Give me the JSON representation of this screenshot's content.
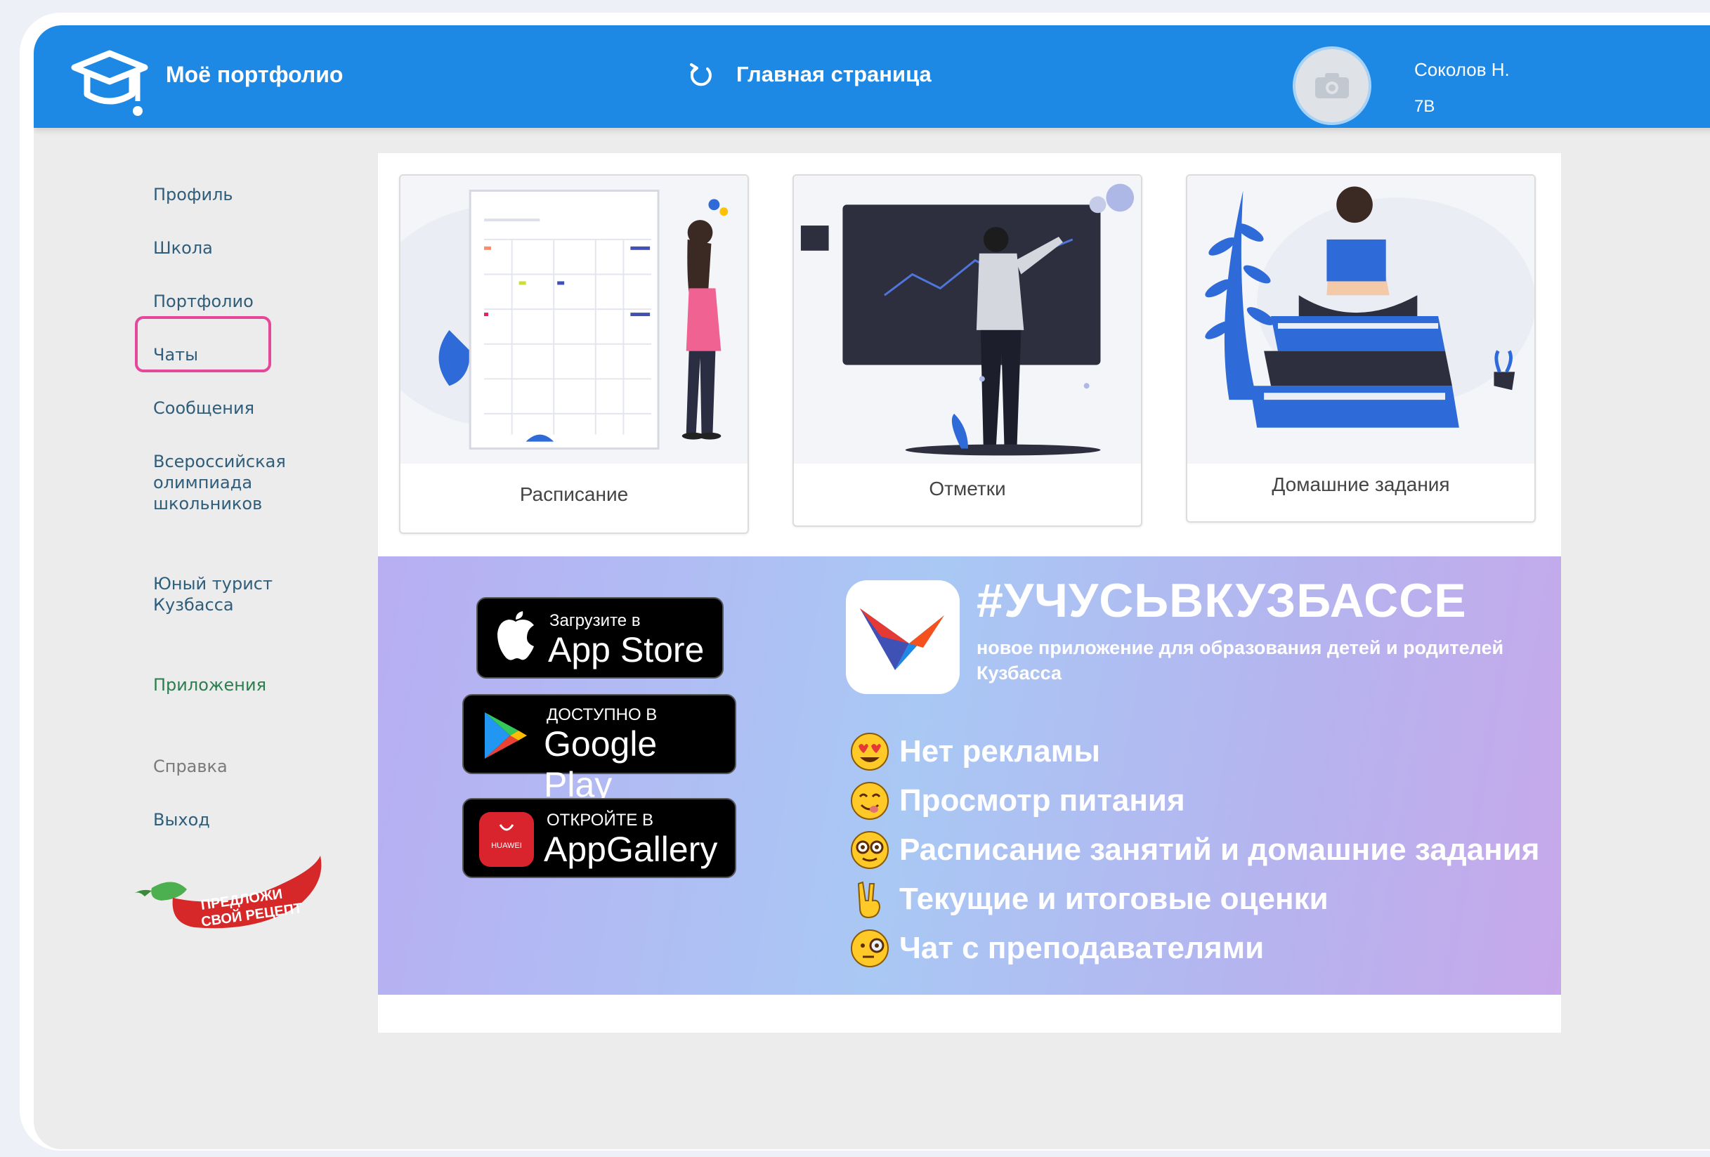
{
  "header": {
    "brand": "Моё портфолио",
    "home_label": "Главная страница",
    "user_name": "Соколов Н.",
    "user_class": "7В"
  },
  "sidebar": {
    "items": [
      {
        "label": "Профиль"
      },
      {
        "label": "Школа"
      },
      {
        "label": "Портфолио"
      },
      {
        "label": "Чаты"
      },
      {
        "label": "Сообщения"
      },
      {
        "label": "Всероссийская олимпиада школьников"
      },
      {
        "label": "Юный турист Кузбасса"
      },
      {
        "label": "Приложения"
      },
      {
        "label": "Справка"
      },
      {
        "label": "Выход"
      }
    ],
    "highlighted": "Чаты",
    "promo_text": "ПРЕДЛОЖИ СВОЙ РЕЦЕПТ"
  },
  "cards": [
    {
      "label": "Расписание"
    },
    {
      "label": "Отметки"
    },
    {
      "label": "Домашние задания"
    }
  ],
  "banner": {
    "stores": [
      {
        "small": "Загрузите в",
        "big": "App Store"
      },
      {
        "small": "ДОСТУПНО В",
        "big": "Google Play"
      },
      {
        "small": "ОТКРОЙТЕ В",
        "big": "AppGallery",
        "brand": "HUAWEI"
      }
    ],
    "hashtag": "#УЧУСЬВКУЗБАССЕ",
    "tagline": "новое приложение для образования детей и родителей Кузбасса",
    "features": [
      {
        "text": "Нет рекламы",
        "icon": "heart-eyes-emoji"
      },
      {
        "text": "Просмотр питания",
        "icon": "yum-emoji"
      },
      {
        "text": "Расписание занятий и домашние задания",
        "icon": "nerd-emoji"
      },
      {
        "text": "Текущие и итоговые оценки",
        "icon": "victory-hand-emoji"
      },
      {
        "text": "Чат с преподавателями",
        "icon": "monocle-emoji"
      }
    ]
  },
  "colors": {
    "header_bg": "#1e88e5",
    "highlight": "#e5479b",
    "banner_from": "#b8aef2",
    "banner_to": "#c7a8ea"
  }
}
